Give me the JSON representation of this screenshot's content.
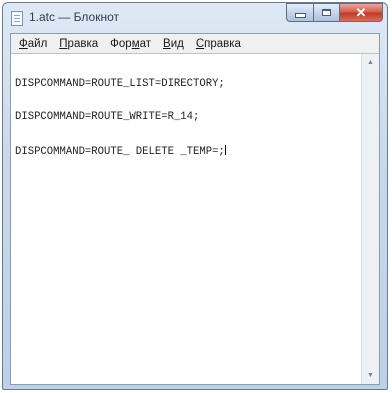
{
  "window": {
    "title": "1.atc — Блокнот"
  },
  "menu": {
    "items": [
      {
        "label": "Файл",
        "accel": "Ф",
        "rest": "айл"
      },
      {
        "label": "Правка",
        "accel": "П",
        "rest": "равка"
      },
      {
        "label": "Формат",
        "accel_pre": "Фор",
        "accel": "м",
        "rest": "ат"
      },
      {
        "label": "Вид",
        "accel": "В",
        "rest": "ид"
      },
      {
        "label": "Справка",
        "accel": "С",
        "rest": "правка"
      }
    ]
  },
  "editor": {
    "lines": [
      "DISPCOMMAND=ROUTE_LIST=DIRECTORY;",
      "DISPCOMMAND=ROUTE_WRITE=R_14;",
      "DISPCOMMAND=ROUTE_ DELETE _TEMP=;"
    ]
  },
  "icons": {
    "app": "notepad-icon",
    "minimize": "minimize-icon",
    "maximize": "maximize-icon",
    "close": "close-icon",
    "scroll_up": "scroll-up-arrow-icon",
    "scroll_down": "scroll-down-arrow-icon"
  },
  "colors": {
    "close_button": "#c0392b",
    "frame": "#c9d9ec"
  }
}
